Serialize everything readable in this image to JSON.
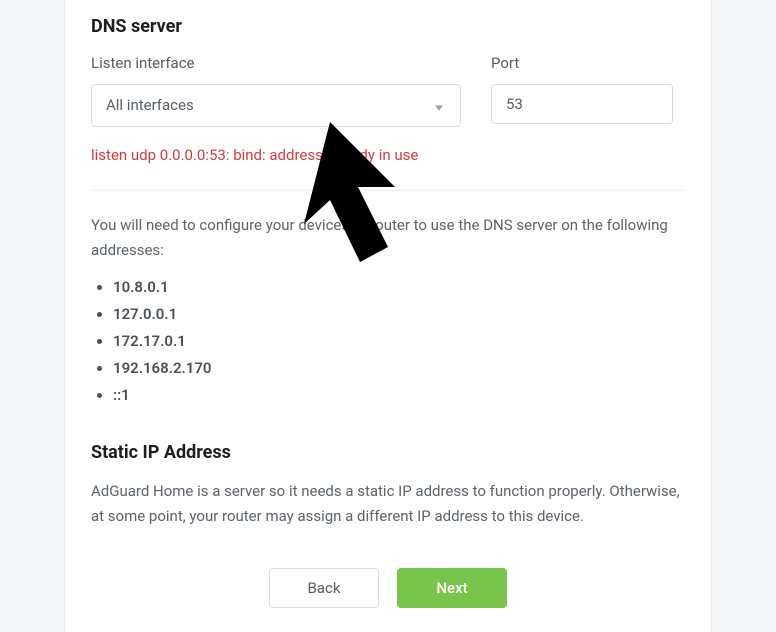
{
  "dns": {
    "heading": "DNS server",
    "listen_label": "Listen interface",
    "listen_value": "All interfaces",
    "port_label": "Port",
    "port_value": "53",
    "error": "listen udp 0.0.0.0:53: bind: address already in use"
  },
  "info": {
    "instruction": "You will need to configure your devices or router to use the DNS server on the following addresses:",
    "addresses": [
      "10.8.0.1",
      "127.0.0.1",
      "172.17.0.1",
      "192.168.2.170",
      "::1"
    ]
  },
  "static": {
    "heading": "Static IP Address",
    "text": "AdGuard Home is a server so it needs a static IP address to function properly. Otherwise, at some point, your router may assign a different IP address to this device."
  },
  "buttons": {
    "back": "Back",
    "next": "Next"
  }
}
